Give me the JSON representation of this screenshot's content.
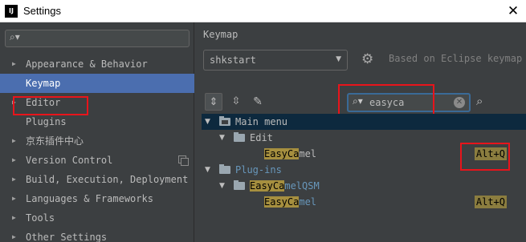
{
  "window": {
    "app_icon_text": "IJ",
    "title": "Settings",
    "close_glyph": "✕"
  },
  "sidebar": {
    "search_icon": "search-icon",
    "search_value": "",
    "items": [
      {
        "label": "Appearance & Behavior",
        "expandable": true
      },
      {
        "label": "Keymap",
        "expandable": false,
        "selected": true
      },
      {
        "label": "Editor",
        "expandable": true
      },
      {
        "label": "Plugins",
        "expandable": false
      },
      {
        "label": "京东插件中心",
        "expandable": true
      },
      {
        "label": "Version Control",
        "expandable": true,
        "has_copy_icon": true
      },
      {
        "label": "Build, Execution, Deployment",
        "expandable": true
      },
      {
        "label": "Languages & Frameworks",
        "expandable": true
      },
      {
        "label": "Tools",
        "expandable": true
      },
      {
        "label": "Other Settings",
        "expandable": true
      }
    ]
  },
  "main": {
    "section_title": "Keymap",
    "scheme_value": "shkstart",
    "based_on": "Based on Eclipse keymap",
    "filter_value": "easyca",
    "tree": {
      "main_menu": "Main menu",
      "edit": "Edit",
      "action_hl": "EasyCa",
      "action_rest": "mel",
      "action_shortcut": "Alt+Q",
      "plugins": "Plug-ins",
      "plugin_hl": "EasyCa",
      "plugin_rest": "melQSM",
      "plugin_action_hl": "EasyCa",
      "plugin_action_rest": "mel",
      "plugin_action_shortcut": "Alt+Q"
    }
  },
  "colors": {
    "background": "#3c3f41",
    "selection": "#4b6eaf",
    "tree_selection": "#0d293e",
    "highlight": "#a68f3f",
    "annotation_red": "#e8141b",
    "plugin_blue": "#6897bb"
  }
}
